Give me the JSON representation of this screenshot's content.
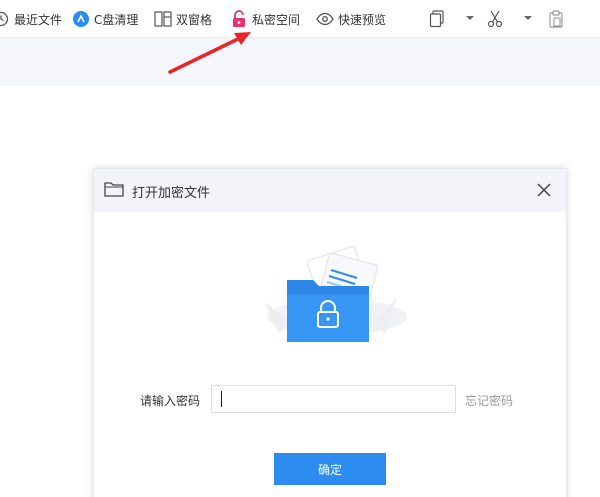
{
  "toolbar": {
    "recent_label": "最近文件",
    "cclean_label": "C盘清理",
    "dualpane_label": "双窗格",
    "private_label": "私密空间",
    "preview_label": "快速预览"
  },
  "dialog": {
    "title": "打开加密文件",
    "password_label": "请输入密码",
    "password_value": "",
    "forgot_label": "忘记密码",
    "confirm_label": "确定"
  },
  "colors": {
    "accent": "#2d8cf0",
    "private_icon": "#e8346e",
    "arrow": "#e8262a",
    "cclean_icon": "#2d8cf0"
  }
}
